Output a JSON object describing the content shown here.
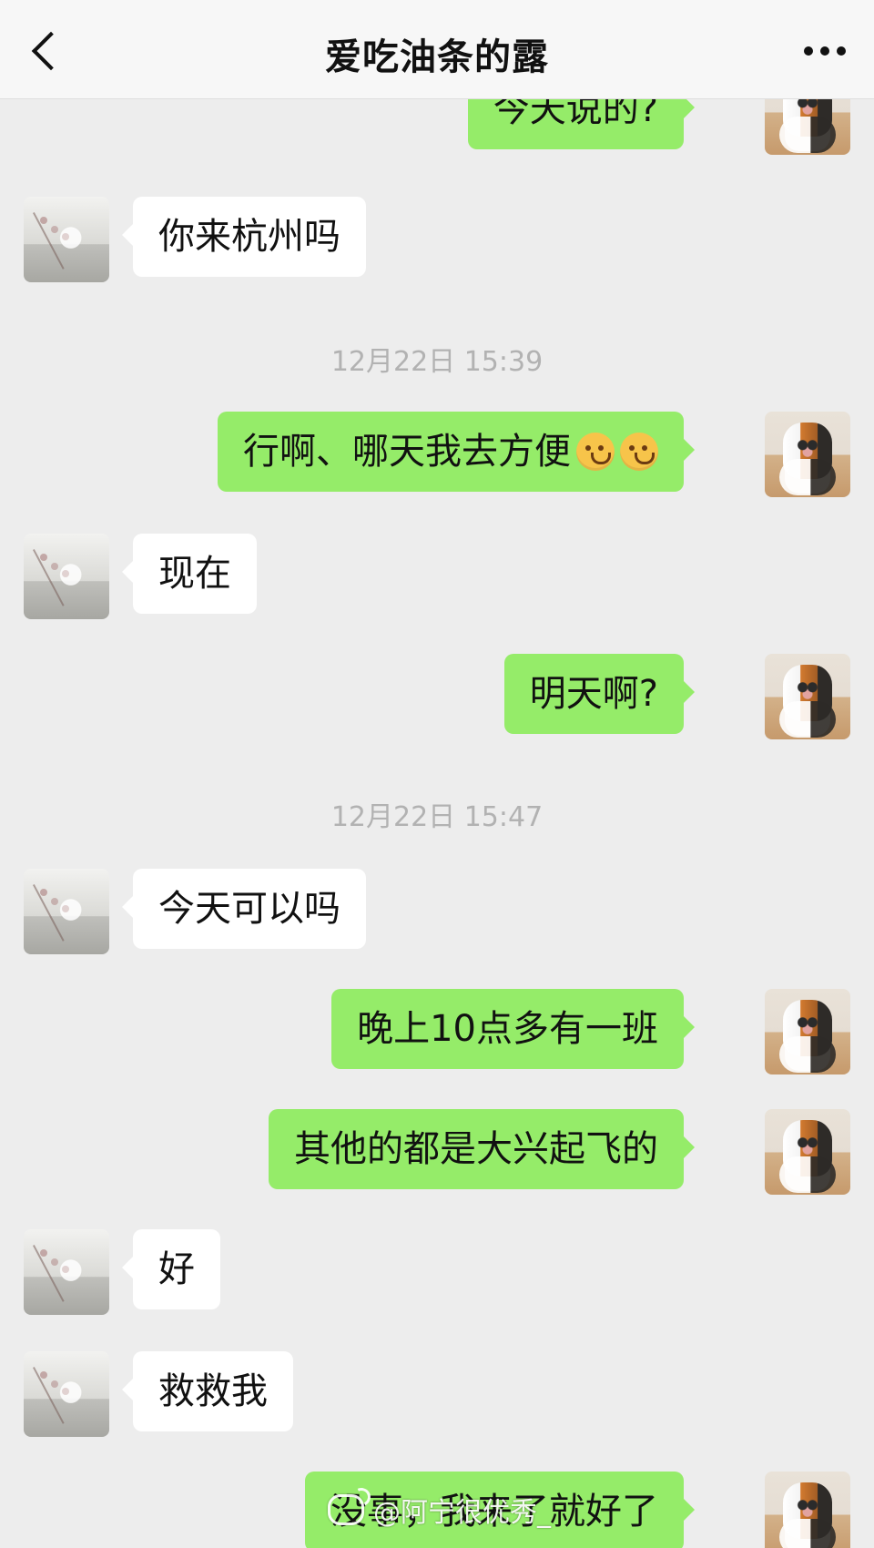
{
  "header": {
    "title": "爱吃油条的露",
    "back_icon": "chevron-left-icon",
    "more_icon": "more-dots-icon"
  },
  "timestamps": [
    "12月22日 15:39",
    "12月22日 15:47"
  ],
  "messages": [
    {
      "side": "right",
      "text": "今天说的?"
    },
    {
      "side": "left",
      "text": "你来杭州吗"
    },
    {
      "side": "right",
      "text": "行啊、哪天我去方便",
      "emoji": [
        "laughing-emoji",
        "laughing-emoji"
      ]
    },
    {
      "side": "left",
      "text": "现在"
    },
    {
      "side": "right",
      "text": "明天啊?"
    },
    {
      "side": "left",
      "text": "今天可以吗"
    },
    {
      "side": "right",
      "text": "晚上10点多有一班"
    },
    {
      "side": "right",
      "text": "其他的都是大兴起飞的"
    },
    {
      "side": "left",
      "text": "好"
    },
    {
      "side": "left",
      "text": "救救我"
    },
    {
      "side": "right",
      "text": "没事，我来了就好了"
    }
  ],
  "watermark": {
    "text": "@阿宁很优秀_",
    "icon": "weibo-icon"
  },
  "colors": {
    "background": "#ededed",
    "header": "#f7f7f7",
    "bubble_me": "#95ec69",
    "bubble_other": "#ffffff"
  }
}
